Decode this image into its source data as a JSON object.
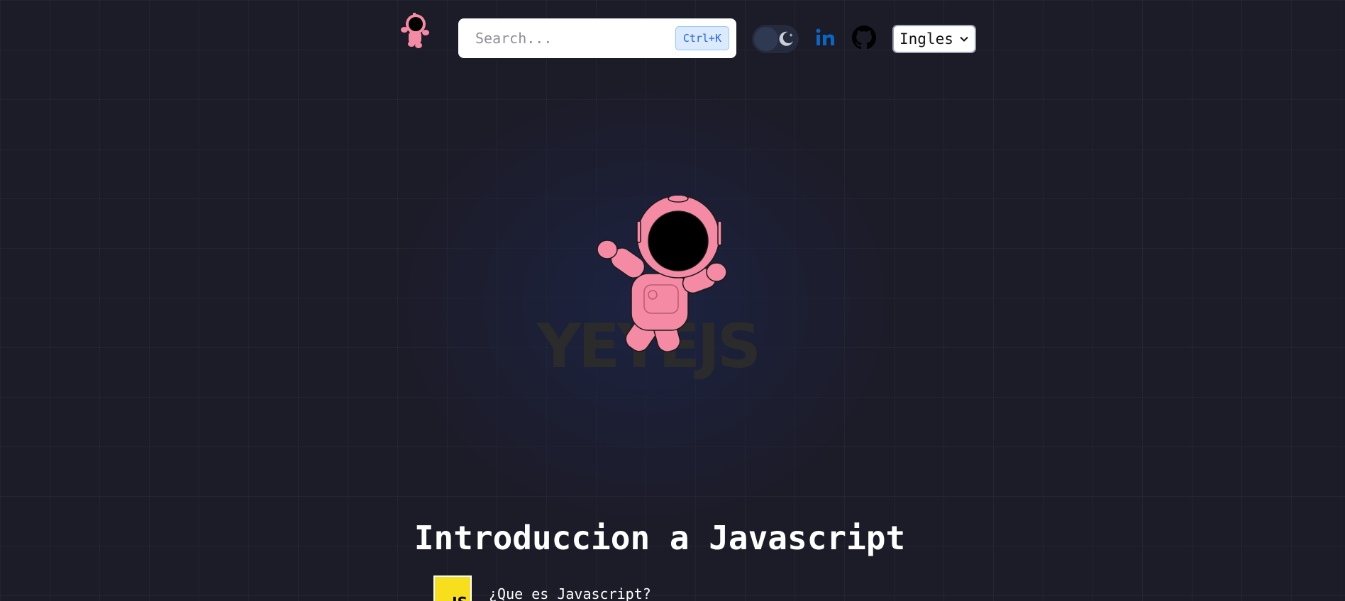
{
  "header": {
    "logo_icon": "astronaut-logo-icon",
    "search": {
      "placeholder": "Search...",
      "shortcut": "Ctrl+K"
    },
    "theme_toggle": {
      "state": "dark",
      "icon": "moon-icon"
    },
    "social": {
      "linkedin_icon": "linkedin-icon",
      "github_icon": "github-icon"
    },
    "language": {
      "selected": "Ingles"
    }
  },
  "hero": {
    "brand_wordmark": "YEYEJS",
    "illustration": "astronaut-illustration"
  },
  "main": {
    "title": "Introduccion a Javascript",
    "lessons": [
      {
        "badge": "JS",
        "label": "¿Que es Javascript?"
      }
    ]
  },
  "colors": {
    "background": "#1c1b28",
    "accent_pink": "#f48aa4",
    "linkedin_blue": "#0a66c2",
    "js_yellow": "#f7df1e",
    "kbd_blue": "#2563eb"
  }
}
